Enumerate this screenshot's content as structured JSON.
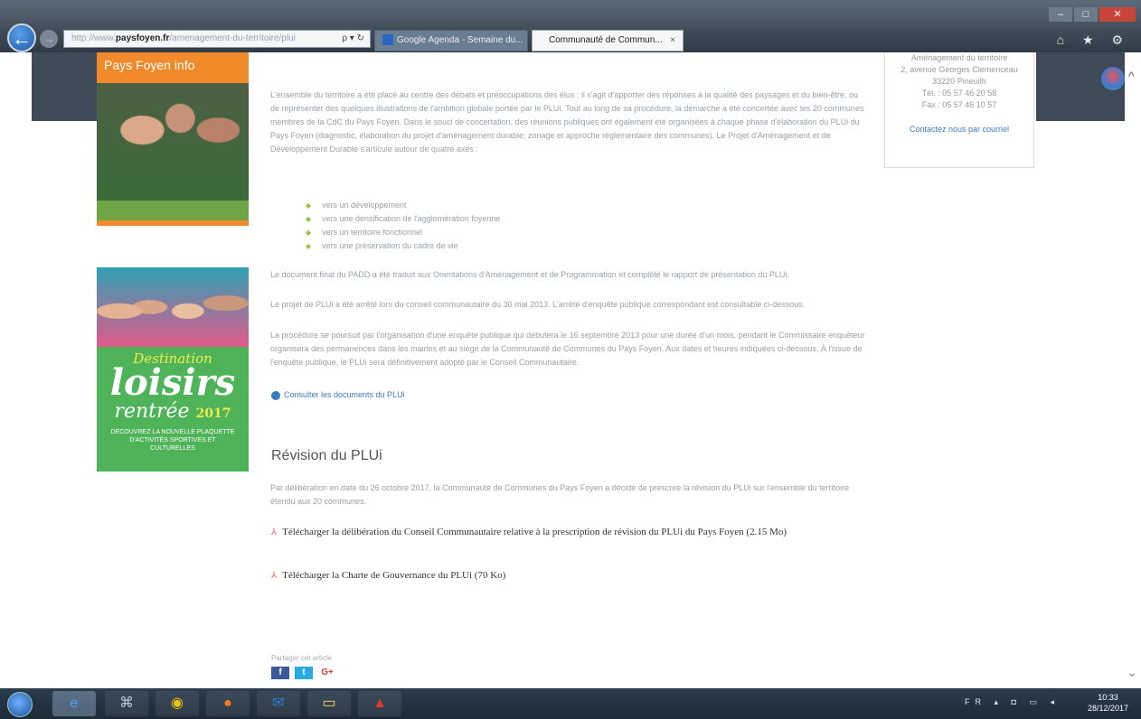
{
  "browser": {
    "address_prefix": "http://www.",
    "address_domain": "paysfoyen.fr",
    "address_rest": "/amenagement-du-territoire/plui",
    "address_icons": "ρ ▾ ↻",
    "tabs": [
      {
        "label": "Google Agenda - Semaine du..."
      },
      {
        "label": "Communauté de Commun..."
      }
    ],
    "tab_close": "×",
    "window_buttons": {
      "minimize": "–",
      "maximize": "□",
      "close": "✕"
    },
    "toolbar_icons": "⌂ ★ ⚙"
  },
  "posters": {
    "poster1_title": "Pays Foyen info",
    "poster2_dest": "Destination",
    "poster2_loisirs": "loisirs",
    "poster2_rentree": "rentrée",
    "poster2_year": "2017",
    "poster2_small": "DÉCOUVREZ LA NOUVELLE PLAQUETTE D'ACTIVITÉS SPORTIVES ET CULTURELLES"
  },
  "contact": {
    "lines": [
      "Aménagement du territoire",
      "2, avenue Georges Clemenceau",
      "33220 Pineuilh",
      "Tél. : 05 57 46 20 58",
      "Fax : 05 57 46 10 57"
    ],
    "mail_label": "Contactez nous par courriel"
  },
  "article": {
    "p1": "L'ensemble du territoire a été placé au centre des débats et préoccupations des élus : il s'agit d'apporter des réponses à la qualité des paysages et du bien-être, ou de représenter des quelques illustrations de l'ambition globale portée par le PLUi. Tout au long de sa procédure, la démarche a été concertée avec les 20 communes membres de la CdC du Pays Foyen. Dans le souci de concertation, des réunions publiques ont également été organisées à chaque phase d'élaboration du PLUi du Pays Foyen (diagnostic, élaboration du projet d'aménagement durable, zonage et approche réglementaire des communes). Le Projet d'Aménagement et de Développement Durable s'articule autour de quatre axes :",
    "bullets": [
      "vers un développement",
      "vers une densification de l'agglomération foyenne",
      "vers un territoire fonctionnel",
      "vers une préservation du cadre de vie"
    ],
    "p2": "Le document final du PADD a été traduit aux Orientations d'Aménagement et de Programmation et complété le rapport de présentation du PLUi.",
    "p3": "Le projet de PLUi a été arrêté lors du conseil communautaire du 30 mai 2013. L'arrêté d'enquête publique correspondant est consultable ci-dessous.",
    "p4": "La procédure se poursuit par l'organisation d'une enquête publique qui débutera le 16 septembre 2013 pour une durée d'un mois, pendant le Commissaire enquêteur organisera des permanences dans les mairies et au siège de la Communauté de Communes du Pays Foyen. Aux dates et heures indiquées ci-dessous. À l'issue de l'enquête publique, le PLUi sera définitivement adopté par le Conseil Communautaire.",
    "doc_link": "Consulter les documents du PLUi"
  },
  "revision": {
    "title": "Révision du PLUi",
    "p5": "Par délibération en date du 26 octobre 2017, la Communauté de Communes du Pays Foyen a décidé de prescrire la révision du PLUi sur l'ensemble du territoire étendu aux 20 communes.",
    "download1": "Télécharger la délibération du Conseil Communautaire relative à la prescription de révision du PLUi du Pays Foyen (2.15 Mo)",
    "download2": "Télécharger la Charte de Gouvernance du PLUi (70 Ko)",
    "pdf_icon": "⅄"
  },
  "share": {
    "label": "Partager cet article",
    "facebook": "f",
    "twitter": "t",
    "googleplus": "G+"
  },
  "taskbar": {
    "apps": [
      "ie-icon",
      "explorer-icon",
      "chrome-icon",
      "firefox-icon",
      "outlook-icon",
      "folder-icon",
      "acrobat-icon"
    ],
    "tray_text": "FR ▴ ◘ ▭ ◂",
    "time": "10:33",
    "date": "28/12/2017"
  },
  "scroll": {
    "up": "^",
    "down": "⌄"
  }
}
